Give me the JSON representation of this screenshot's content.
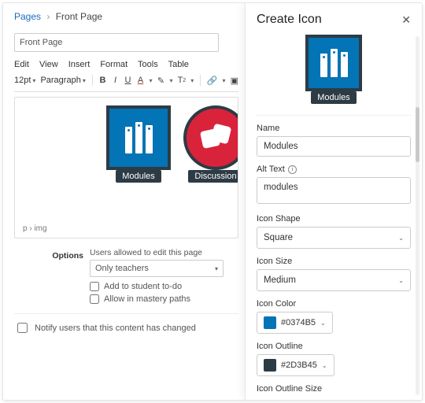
{
  "breadcrumb": {
    "root": "Pages",
    "current": "Front Page"
  },
  "page": {
    "title": "Front Page"
  },
  "menubar": [
    "Edit",
    "View",
    "Insert",
    "Format",
    "Tools",
    "Table"
  ],
  "toolbar": {
    "font_size": "12pt",
    "block_format": "Paragraph"
  },
  "canvas": {
    "icons": [
      {
        "label": "Modules"
      },
      {
        "label": "Discussion"
      }
    ],
    "path": "p › img"
  },
  "options": {
    "label": "Options",
    "editors_caption": "Users allowed to edit this page",
    "editors_value": "Only teachers",
    "add_todo": "Add to student to-do",
    "mastery": "Allow in mastery paths"
  },
  "footer": {
    "notify": "Notify users that this content has changed"
  },
  "panel": {
    "title": "Create Icon",
    "preview_label": "Modules",
    "fields": {
      "name": {
        "label": "Name",
        "value": "Modules"
      },
      "alt": {
        "label": "Alt Text",
        "value": "modules"
      },
      "shape": {
        "label": "Icon Shape",
        "value": "Square"
      },
      "size": {
        "label": "Icon Size",
        "value": "Medium"
      },
      "color": {
        "label": "Icon Color",
        "value": "#0374B5"
      },
      "outline": {
        "label": "Icon Outline",
        "value": "#2D3B45"
      },
      "outline_size": {
        "label": "Icon Outline Size"
      }
    }
  }
}
